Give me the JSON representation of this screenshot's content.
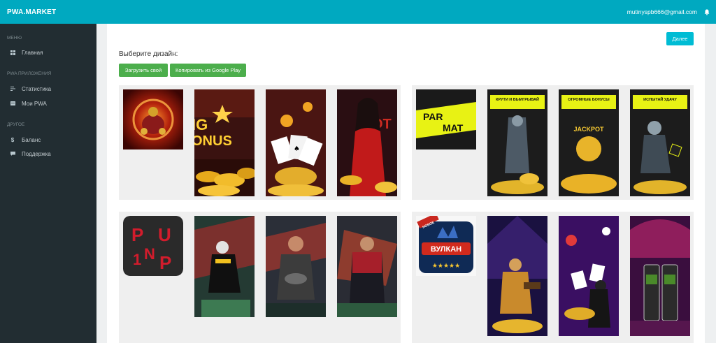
{
  "topbar": {
    "brand": "PWA.MARKET",
    "email": "mutinyspb666@gmail.com",
    "icon": "bell-icon"
  },
  "sidebar": {
    "sections": [
      {
        "title": "МЕНЮ",
        "items": [
          {
            "label": "Главная",
            "icon": "dashboard-icon"
          }
        ]
      },
      {
        "title": "PWA ПРИЛОЖЕНИЯ",
        "items": [
          {
            "label": "Статистика",
            "icon": "stats-icon"
          },
          {
            "label": "Мои PWA",
            "icon": "list-icon"
          }
        ]
      },
      {
        "title": "ДРУГОЕ",
        "items": [
          {
            "label": "Баланс",
            "icon": "dollar-icon"
          },
          {
            "label": "Поддержка",
            "icon": "chat-icon"
          }
        ]
      }
    ]
  },
  "main": {
    "title": "Выберите дизайн:",
    "next_button": "Далее",
    "upload_button": "Загрузить свой",
    "copy_button": "Копировать из Google Play"
  },
  "designs": [
    {
      "name": "casino-design-1",
      "texts": [
        "IG",
        "ONUS",
        "OT"
      ]
    },
    {
      "name": "parimatch-design",
      "texts": [
        "PAR",
        "MAT",
        "КРУТИ И ВЫИГРЫВАЙ",
        "ОГРОМНЫЕ БОНУСЫ",
        "JACKPOT",
        "ИСПЫТАЙ УДАЧУ"
      ]
    },
    {
      "name": "pinup-sport-design",
      "texts": [
        "P",
        "U",
        "1",
        "N",
        "P"
      ]
    },
    {
      "name": "vulkan-design",
      "texts": [
        "НОВОЕ",
        "ВУЛКАН",
        "★★★★★"
      ]
    }
  ],
  "colors": {
    "topbar": "#00a9c0",
    "sidebar": "#222d32",
    "green": "#4cae4c",
    "cyan": "#00bcd4",
    "parimatch_yellow": "#e8f214"
  }
}
